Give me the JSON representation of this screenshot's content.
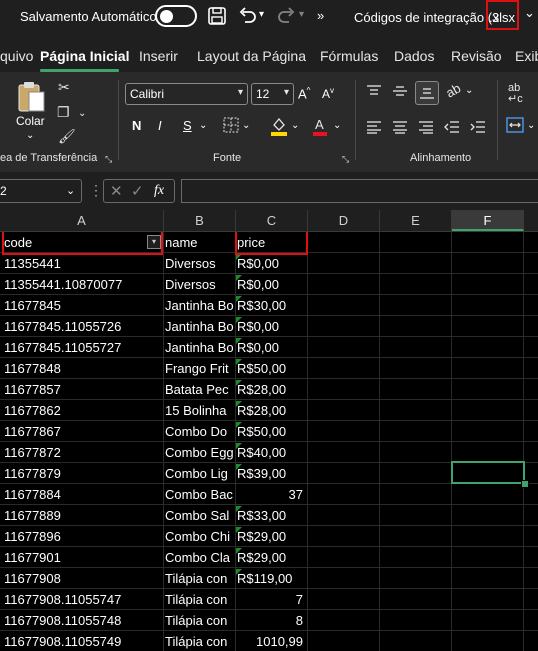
{
  "titlebar": {
    "autosave_label": "Salvamento Automático",
    "filename": "Códigos de integração (3",
    "extension": ".xlsx",
    "chevron": "⌄"
  },
  "tabs": [
    "quivo",
    "Página Inicial",
    "Inserir",
    "Layout da Página",
    "Fórmulas",
    "Dados",
    "Revisão",
    "Exib"
  ],
  "ribbon": {
    "clipboard": {
      "paste_label": "Colar",
      "group_label": "ea de Transferência"
    },
    "font": {
      "font_name": "Calibri",
      "font_size": "12",
      "bold": "N",
      "italic": "I",
      "underline": "S",
      "group_label": "Fonte"
    },
    "alignment": {
      "group_label": "Alinhamento"
    }
  },
  "formula_bar": {
    "name_box": "2",
    "fx": "fx",
    "value": ""
  },
  "columns": [
    "A",
    "B",
    "C",
    "D",
    "E",
    "F"
  ],
  "header_row": {
    "a": "code",
    "b": "name",
    "c": "price"
  },
  "rows": [
    {
      "a": "11355441",
      "b": "Diversos",
      "c": "R$0,00"
    },
    {
      "a": "11355441.10870077",
      "b": "Diversos",
      "c": "R$0,00"
    },
    {
      "a": "11677845",
      "b": "Jantinha Bo",
      "c": "R$30,00"
    },
    {
      "a": "11677845.11055726",
      "b": "Jantinha Bo",
      "c": "R$0,00"
    },
    {
      "a": "11677845.11055727",
      "b": "Jantinha Bo",
      "c": "R$0,00"
    },
    {
      "a": "11677848",
      "b": "Frango Frit",
      "c": "R$50,00"
    },
    {
      "a": "11677857",
      "b": "Batata Pec",
      "c": "R$28,00"
    },
    {
      "a": "11677862",
      "b": "15 Bolinha",
      "c": "R$28,00"
    },
    {
      "a": "11677867",
      "b": "Combo Do",
      "c": "R$50,00"
    },
    {
      "a": "11677872",
      "b": "Combo Egg",
      "c": "R$40,00"
    },
    {
      "a": "11677879",
      "b": "Combo Lig",
      "c": "R$39,00"
    },
    {
      "a": "11677884",
      "b": "Combo Bac",
      "c": "37"
    },
    {
      "a": "11677889",
      "b": "Combo Sal",
      "c": "R$33,00"
    },
    {
      "a": "11677896",
      "b": "Combo Chi",
      "c": "R$29,00"
    },
    {
      "a": "11677901",
      "b": "Combo Cla",
      "c": "R$29,00"
    },
    {
      "a": "11677908",
      "b": "Tilápia con",
      "c": "R$119,00"
    },
    {
      "a": "11677908.11055747",
      "b": "Tilápia con",
      "c": "7"
    },
    {
      "a": "11677908.11055748",
      "b": "Tilápia con",
      "c": "8"
    },
    {
      "a": "11677908.11055749",
      "b": "Tilápia con",
      "c": "1010,99"
    }
  ],
  "colors": {
    "accent": "#3fa36b",
    "highlight_box": "#dd1111",
    "comment_marker": "#1a8a2a"
  }
}
